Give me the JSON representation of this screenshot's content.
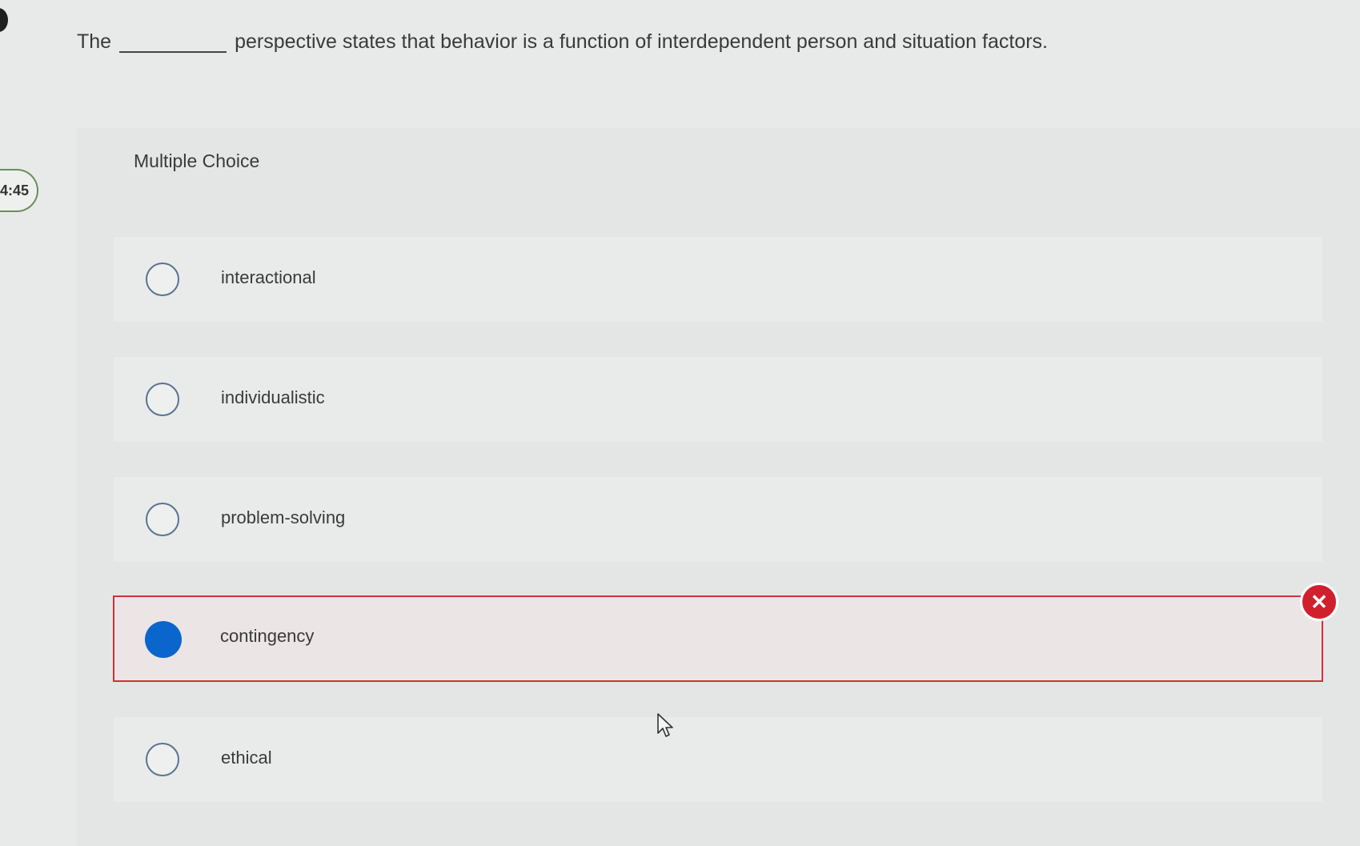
{
  "timer": "4:45",
  "question": {
    "prefix": "The",
    "suffix": "perspective states that behavior is a function of interdependent person and situation factors."
  },
  "multiple_choice": {
    "label": "Multiple Choice",
    "options": [
      {
        "label": "interactional",
        "selected": false
      },
      {
        "label": "individualistic",
        "selected": false
      },
      {
        "label": "problem-solving",
        "selected": false
      },
      {
        "label": "contingency",
        "selected": true,
        "status": "incorrect"
      },
      {
        "label": "ethical",
        "selected": false
      }
    ]
  },
  "icons": {
    "incorrect": "close-icon",
    "cursor": "mouse-pointer-icon"
  },
  "colors": {
    "selected_radio": "#0a66cc",
    "incorrect": "#d0303c",
    "timer_border": "#6a8f5a"
  }
}
